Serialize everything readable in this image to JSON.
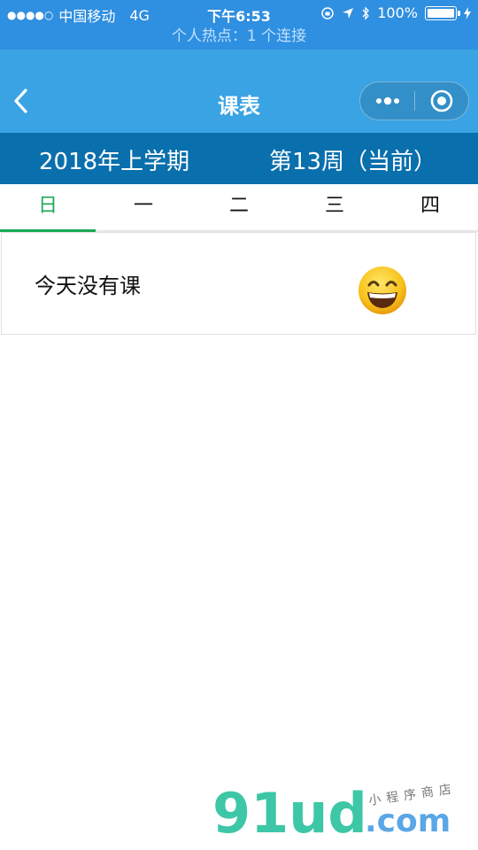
{
  "status_bar": {
    "signal": "●●●●○",
    "carrier": "中国移动",
    "network": "4G",
    "time": "下午6:53",
    "battery_percent": "100%"
  },
  "hotspot_bar": {
    "text": "个人热点：1 个连接"
  },
  "nav": {
    "title": "课表",
    "back_icon": "chevron-left-icon",
    "more_icon": "ellipsis-icon",
    "close_icon": "target-circle-icon"
  },
  "term_bar": {
    "term": "2018年上学期",
    "week": "第13周（当前）"
  },
  "tabs": [
    {
      "label": "日",
      "active": true
    },
    {
      "label": "一",
      "active": false
    },
    {
      "label": "二",
      "active": false
    },
    {
      "label": "三",
      "active": false
    },
    {
      "label": "四",
      "active": false
    }
  ],
  "empty_state": {
    "text": "今天没有课",
    "emoji": "grinning-face-emoji"
  },
  "watermark": {
    "logo": "91ud",
    "domain": ".com",
    "tagline": "小程序商店"
  },
  "colors": {
    "status_bar": "#2f8fe0",
    "nav_bar": "#3aa3e3",
    "term_bar": "#0a6fad",
    "tab_active": "#1aaa55"
  }
}
